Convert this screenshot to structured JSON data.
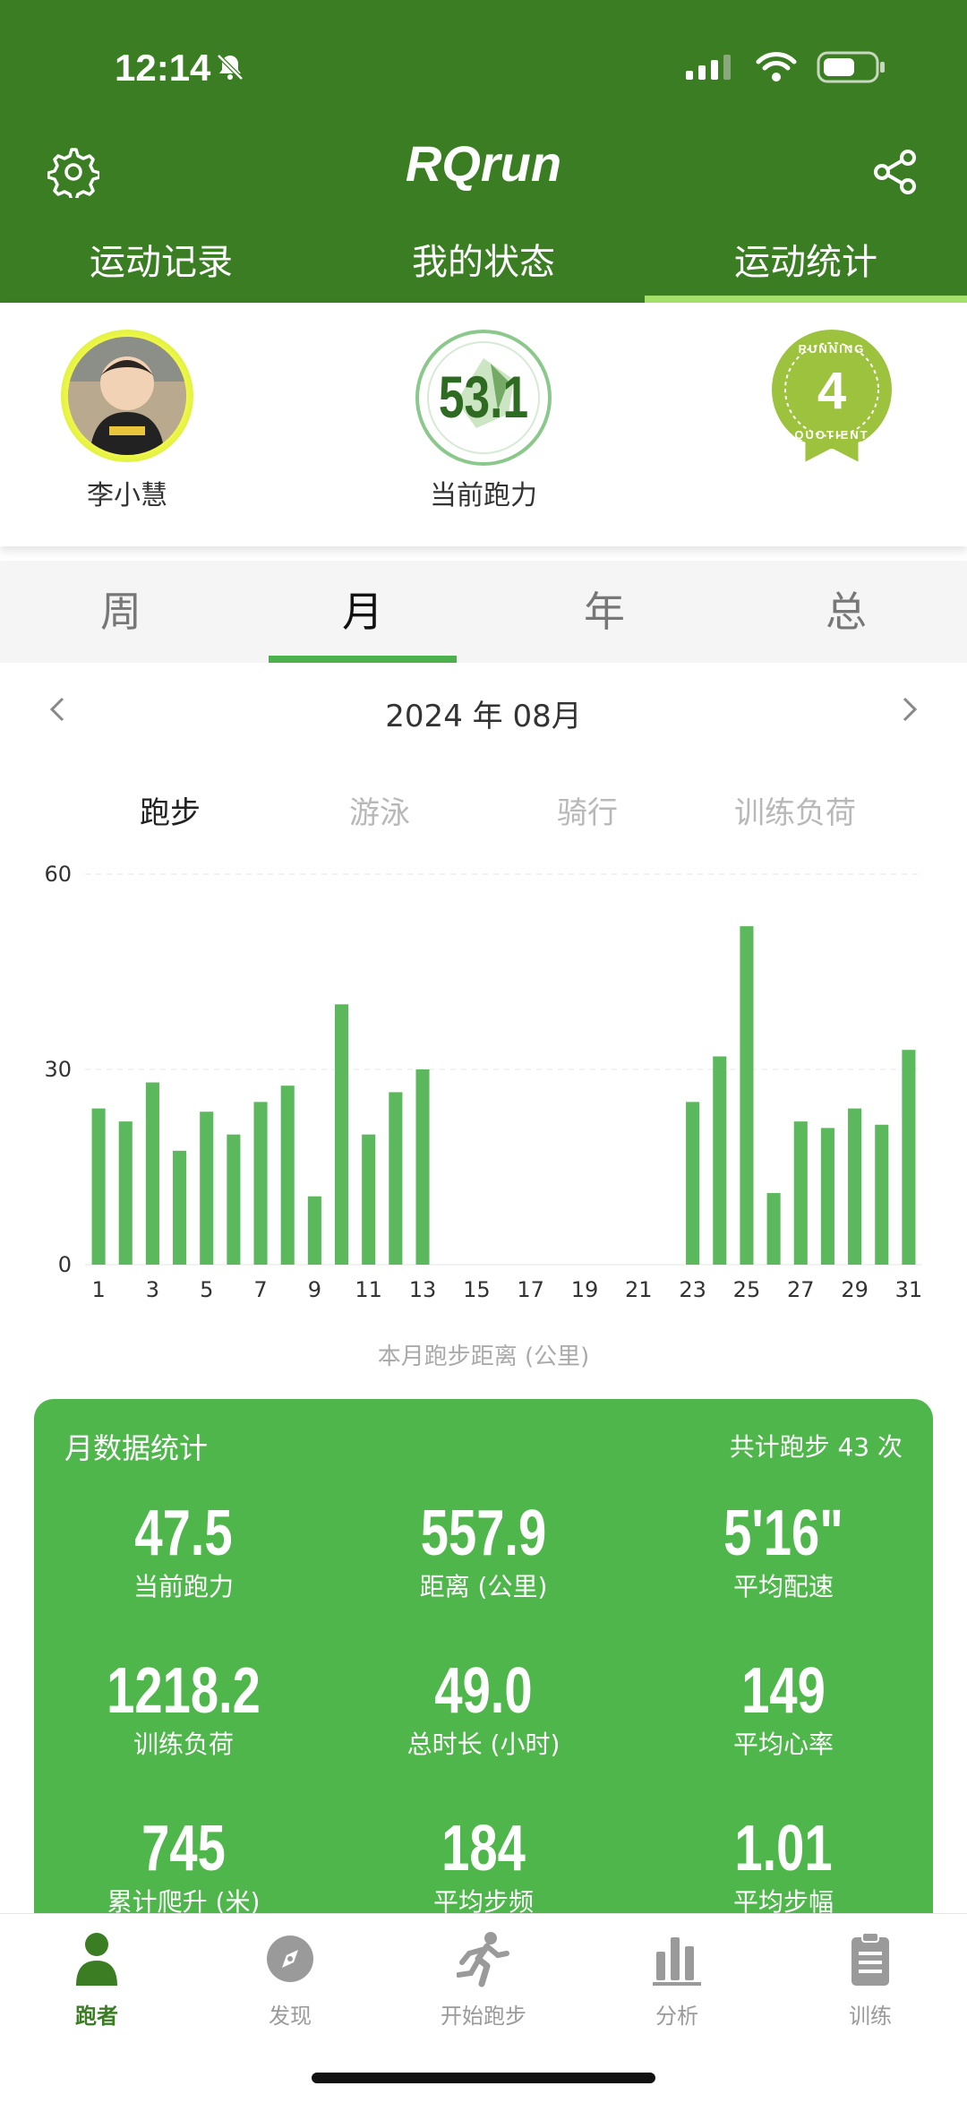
{
  "status_bar": {
    "time": "12:14"
  },
  "app": {
    "title": "RQrun"
  },
  "top_tabs": [
    {
      "label": "运动记录"
    },
    {
      "label": "我的状态"
    },
    {
      "label": "运动统计"
    }
  ],
  "profile": {
    "name": "李小慧",
    "running_power_value": "53.1",
    "running_power_label": "当前跑力",
    "badge_number": "4",
    "badge_text": "RUNNING QUOTIENT"
  },
  "period_tabs": [
    {
      "label": "周"
    },
    {
      "label": "月"
    },
    {
      "label": "年"
    },
    {
      "label": "总"
    }
  ],
  "month_nav": {
    "label": "2024 年 08月"
  },
  "sport_tabs": [
    {
      "label": "跑步"
    },
    {
      "label": "游泳"
    },
    {
      "label": "骑行"
    },
    {
      "label": "训练负荷"
    }
  ],
  "chart_data": {
    "type": "bar",
    "categories": [
      1,
      2,
      3,
      4,
      5,
      6,
      7,
      8,
      9,
      10,
      11,
      12,
      13,
      14,
      15,
      16,
      17,
      18,
      19,
      20,
      21,
      22,
      23,
      24,
      25,
      26,
      27,
      28,
      29,
      30,
      31
    ],
    "values": [
      24,
      22,
      28,
      17.5,
      23.5,
      20,
      25,
      27.5,
      10.5,
      40,
      20,
      26.5,
      30,
      0,
      0,
      0,
      0,
      0,
      0,
      0,
      0,
      0,
      25,
      32,
      52,
      11,
      22,
      21,
      24,
      21.5,
      33
    ],
    "x_tick_labels": [
      "1",
      "3",
      "5",
      "7",
      "9",
      "11",
      "13",
      "15",
      "17",
      "19",
      "21",
      "23",
      "25",
      "27",
      "29",
      "31"
    ],
    "y_tick_labels": [
      "60",
      "30",
      "0"
    ],
    "ylim": [
      0,
      60
    ],
    "xlabel": "本月跑步距离 (公里)",
    "ylabel": "",
    "grid": true,
    "bar_color": "#5cb85c"
  },
  "stats": {
    "title": "月数据统计",
    "count_text": "共计跑步 43 次",
    "items": [
      {
        "value": "47.5",
        "label": "当前跑力"
      },
      {
        "value": "557.9",
        "label": "距离 (公里)"
      },
      {
        "value": "5'16\"",
        "label": "平均配速"
      },
      {
        "value": "1218.2",
        "label": "训练负荷"
      },
      {
        "value": "49.0",
        "label": "总时长 (小时)"
      },
      {
        "value": "149",
        "label": "平均心率"
      },
      {
        "value": "745",
        "label": "累计爬升 (米)"
      },
      {
        "value": "184",
        "label": "平均步频"
      },
      {
        "value": "1.01",
        "label": "平均步幅"
      }
    ]
  },
  "bottom_nav": [
    {
      "label": "跑者",
      "icon": "person-icon"
    },
    {
      "label": "发现",
      "icon": "compass-icon"
    },
    {
      "label": "开始跑步",
      "icon": "runner-icon"
    },
    {
      "label": "分析",
      "icon": "bar-chart-icon"
    },
    {
      "label": "训练",
      "icon": "clipboard-icon"
    }
  ],
  "colors": {
    "header": "#3b7d23",
    "accent": "#a5e06a",
    "card": "#4fb64b",
    "bar": "#5cb85c",
    "active_nav": "#3b7d23"
  }
}
